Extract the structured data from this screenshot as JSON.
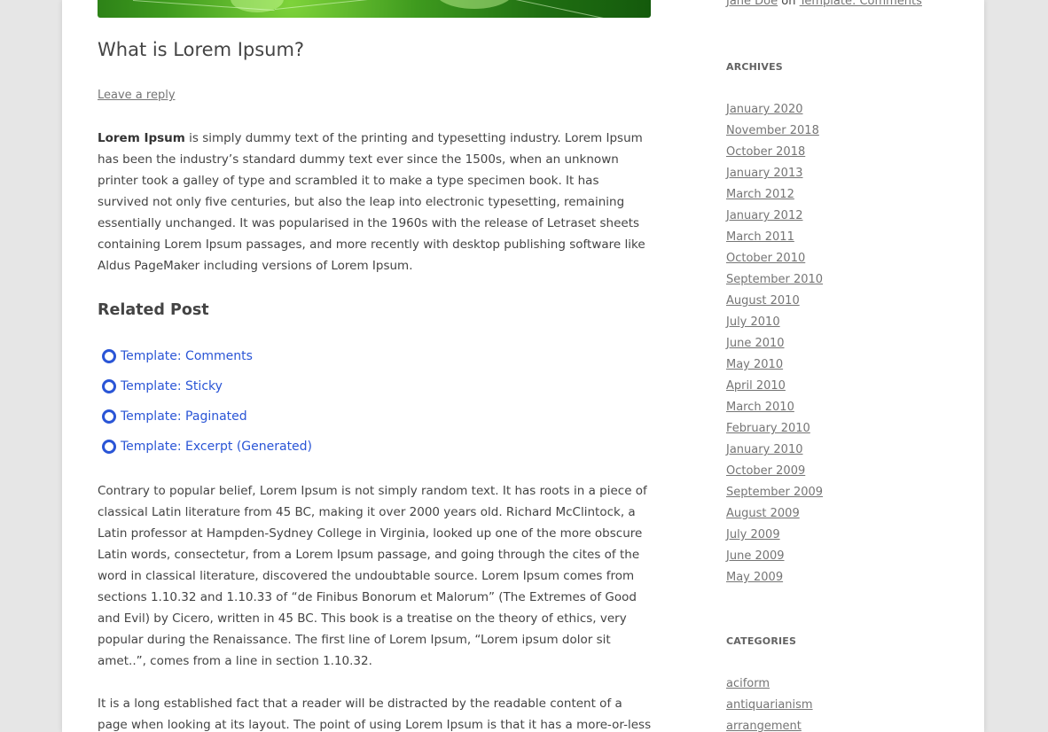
{
  "post": {
    "title": "What is Lorem Ipsum?",
    "reply_link": "Leave a reply",
    "intro_bold": "Lorem Ipsum",
    "intro_rest": " is simply dummy text of the printing and typesetting industry. Lorem Ipsum has been the industry’s standard dummy text ever since the 1500s, when an unknown printer took a galley of type and scrambled it to make a type specimen book. It has survived not only five centuries, but also the leap into electronic typesetting, remaining essentially unchanged. It was popularised in the 1960s with the release of Letraset sheets containing Lorem Ipsum passages, and more recently with desktop publishing software like Aldus PageMaker including versions of Lorem Ipsum.",
    "related_title": "Related Post",
    "related_posts": [
      "Template: Comments",
      "Template: Sticky",
      "Template: Paginated",
      "Template: Excerpt (Generated)"
    ],
    "paragraph_2": "Contrary to popular belief, Lorem Ipsum is not simply random text. It has roots in a piece of classical Latin literature from 45 BC, making it over 2000 years old. Richard McClintock, a Latin professor at Hampden-Sydney College in Virginia, looked up one of the more obscure Latin words, consectetur, from a Lorem Ipsum passage, and going through the cites of the word in classical literature, discovered the undoubtable source. Lorem Ipsum comes from sections 1.10.32 and 1.10.33 of “de Finibus Bonorum et Malorum” (The Extremes of Good and Evil) by Cicero, written in 45 BC. This book is a treatise on the theory of ethics, very popular during the Renaissance. The first line of Lorem Ipsum, “Lorem ipsum dolor sit amet..”, comes from a line in section 1.10.32.",
    "paragraph_3": "It is a long established fact that a reader will be distracted by the readable content of a page when looking at its layout. The point of using Lorem Ipsum is that it has a more-or-less normal"
  },
  "sidebar": {
    "recent_comment": {
      "author": "Jane Doe",
      "connector": "on",
      "post": "Template: Comments"
    },
    "archives_title": "ARCHIVES",
    "archives": [
      "January 2020",
      "November 2018",
      "October 2018",
      "January 2013",
      "March 2012",
      "January 2012",
      "March 2011",
      "October 2010",
      "September 2010",
      "August 2010",
      "July 2010",
      "June 2010",
      "May 2010",
      "April 2010",
      "March 2010",
      "February 2010",
      "January 2010",
      "October 2009",
      "September 2009",
      "August 2009",
      "July 2009",
      "June 2009",
      "May 2009"
    ],
    "categories_title": "CATEGORIES",
    "categories": [
      "aciform",
      "antiquarianism",
      "arrangement"
    ]
  },
  "colors": {
    "link_blue": "#2a55d6",
    "link_gray": "#757575",
    "text": "#444444",
    "background": "#e6e6e6"
  }
}
